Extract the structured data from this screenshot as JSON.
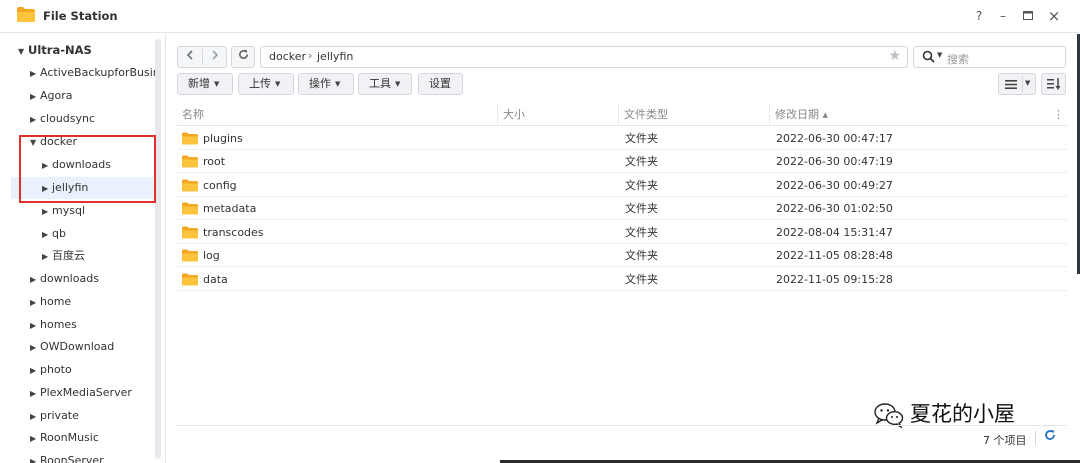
{
  "window": {
    "title": "File Station",
    "buttons": {
      "help": "?",
      "minimize": "–",
      "maximize": "□",
      "close": "×"
    }
  },
  "sidebar": {
    "root": "Ultra-NAS",
    "items": [
      {
        "label": "ActiveBackupforBusir",
        "expanded": false,
        "level": 1
      },
      {
        "label": "Agora",
        "expanded": false,
        "level": 1
      },
      {
        "label": "cloudsync",
        "expanded": false,
        "level": 1
      },
      {
        "label": "docker",
        "expanded": true,
        "level": 1
      },
      {
        "label": "downloads",
        "expanded": false,
        "level": 2
      },
      {
        "label": "jellyfin",
        "expanded": false,
        "level": 2,
        "selected": true
      },
      {
        "label": "mysql",
        "expanded": false,
        "level": 2
      },
      {
        "label": "qb",
        "expanded": false,
        "level": 2
      },
      {
        "label": "百度云",
        "expanded": false,
        "level": 2
      },
      {
        "label": "downloads",
        "expanded": false,
        "level": 1
      },
      {
        "label": "home",
        "expanded": false,
        "level": 1
      },
      {
        "label": "homes",
        "expanded": false,
        "level": 1
      },
      {
        "label": "OWDownload",
        "expanded": false,
        "level": 1
      },
      {
        "label": "photo",
        "expanded": false,
        "level": 1
      },
      {
        "label": "PlexMediaServer",
        "expanded": false,
        "level": 1
      },
      {
        "label": "private",
        "expanded": false,
        "level": 1
      },
      {
        "label": "RoonMusic",
        "expanded": false,
        "level": 1
      },
      {
        "label": "RoonServer",
        "expanded": false,
        "level": 1
      }
    ]
  },
  "path": {
    "crumbs": [
      "docker",
      "jellyfin"
    ],
    "separator": "›"
  },
  "search": {
    "placeholder": "搜索"
  },
  "toolbar": {
    "new_label": "新增",
    "upload_label": "上传",
    "action_label": "操作",
    "tools_label": "工具",
    "settings_label": "设置"
  },
  "table": {
    "headers": {
      "name": "名称",
      "size": "大小",
      "type": "文件类型",
      "modified": "修改日期 ▴"
    },
    "rows": [
      {
        "name": "plugins",
        "size": "",
        "type": "文件夹",
        "modified": "2022-06-30 00:47:17"
      },
      {
        "name": "root",
        "size": "",
        "type": "文件夹",
        "modified": "2022-06-30 00:47:19"
      },
      {
        "name": "config",
        "size": "",
        "type": "文件夹",
        "modified": "2022-06-30 00:49:27"
      },
      {
        "name": "metadata",
        "size": "",
        "type": "文件夹",
        "modified": "2022-06-30 01:02:50"
      },
      {
        "name": "transcodes",
        "size": "",
        "type": "文件夹",
        "modified": "2022-08-04 15:31:47"
      },
      {
        "name": "log",
        "size": "",
        "type": "文件夹",
        "modified": "2022-11-05 08:28:48"
      },
      {
        "name": "data",
        "size": "",
        "type": "文件夹",
        "modified": "2022-11-05 09:15:28"
      }
    ]
  },
  "status": {
    "item_count": "7 个项目"
  },
  "watermark": {
    "text": "夏花的小屋"
  },
  "colors": {
    "folder": "#f5b21f",
    "accent": "#1f6fc5",
    "highlight_box": "#e0302e",
    "selected_bg": "#e8f1fc"
  }
}
